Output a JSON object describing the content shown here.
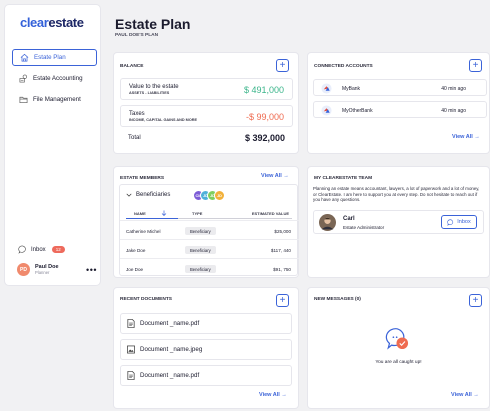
{
  "logo": {
    "part1": "clear",
    "part2": "estate"
  },
  "sidebar": {
    "items": [
      {
        "label": "Estate Plan",
        "icon": "house-icon",
        "active": true
      },
      {
        "label": "Estate Accounting",
        "icon": "accounting-icon",
        "active": false
      },
      {
        "label": "File Management",
        "icon": "folder-icon",
        "active": false
      }
    ],
    "inbox": {
      "label": "Inbox",
      "badge": "12"
    },
    "user": {
      "initials": "PD",
      "name": "Paul Doe",
      "role": "Planner"
    }
  },
  "page": {
    "title": "Estate Plan",
    "subtitle": "PAUL DOE'S PLAN"
  },
  "balance": {
    "title": "BALANCE",
    "rows": [
      {
        "label": "Value to the estate",
        "sub": "ASSETS - LIABILITIES",
        "value": "$ 491,000"
      },
      {
        "label": "Taxes",
        "sub": "INCOME, CAPITAL GAINS AND MORE",
        "value": "-$ 99,000"
      }
    ],
    "total_label": "Total",
    "total_value": "$ 392,000",
    "colors": {
      "positive": "#3bb58b",
      "negative": "#ef6b50"
    }
  },
  "accounts": {
    "title": "CONNECTED ACCOUNTS",
    "items": [
      {
        "name": "MyBank",
        "time": "40 min ago"
      },
      {
        "name": "MyOtherBank",
        "time": "40 min ago"
      }
    ],
    "view_all": "View All"
  },
  "members": {
    "title": "ESTATE MEMBERS",
    "view_all": "View All",
    "group": "Beneficiaries",
    "chips": [
      {
        "initials": "CM",
        "color": "#7c5cd6"
      },
      {
        "initials": "JD",
        "color": "#4fb0d9"
      },
      {
        "initials": "JD",
        "color": "#7fcf5f"
      },
      {
        "initials": "JD",
        "color": "#f2b13a"
      }
    ],
    "columns": [
      "NAME",
      "TYPE",
      "ESTIMATED VALUE"
    ],
    "rows": [
      {
        "name": "Catherine Michel",
        "type": "Beneficiary",
        "value": "$25,000"
      },
      {
        "name": "Jake Doe",
        "type": "Beneficiary",
        "value": "$117, 440"
      },
      {
        "name": "Joe Doe",
        "type": "Beneficiary",
        "value": "$91, 750"
      }
    ]
  },
  "team": {
    "title": "MY CLEARESTATE TEAM",
    "text": "Planning an estate means accountant, lawyers, a lot of paperwork and a lot of money, or ClearEstate. I am here to support you at every step. Do not hesitate to reach out if you have any questions.",
    "member": {
      "name": "Carl",
      "role": "Estate Administrator"
    },
    "inbox_label": "Inbox"
  },
  "documents": {
    "title": "RECENT DOCUMENTS",
    "items": [
      {
        "name": "Document _name.pdf",
        "icon": "document-icon"
      },
      {
        "name": "Document _name.jpeg",
        "icon": "image-icon"
      },
      {
        "name": "Document _name.pdf",
        "icon": "document-icon"
      }
    ],
    "view_all": "View All"
  },
  "messages": {
    "title": "NEW MESSAGES (0)",
    "empty": "You are all caught up!",
    "view_all": "View All"
  },
  "accent": "#3b63d8"
}
